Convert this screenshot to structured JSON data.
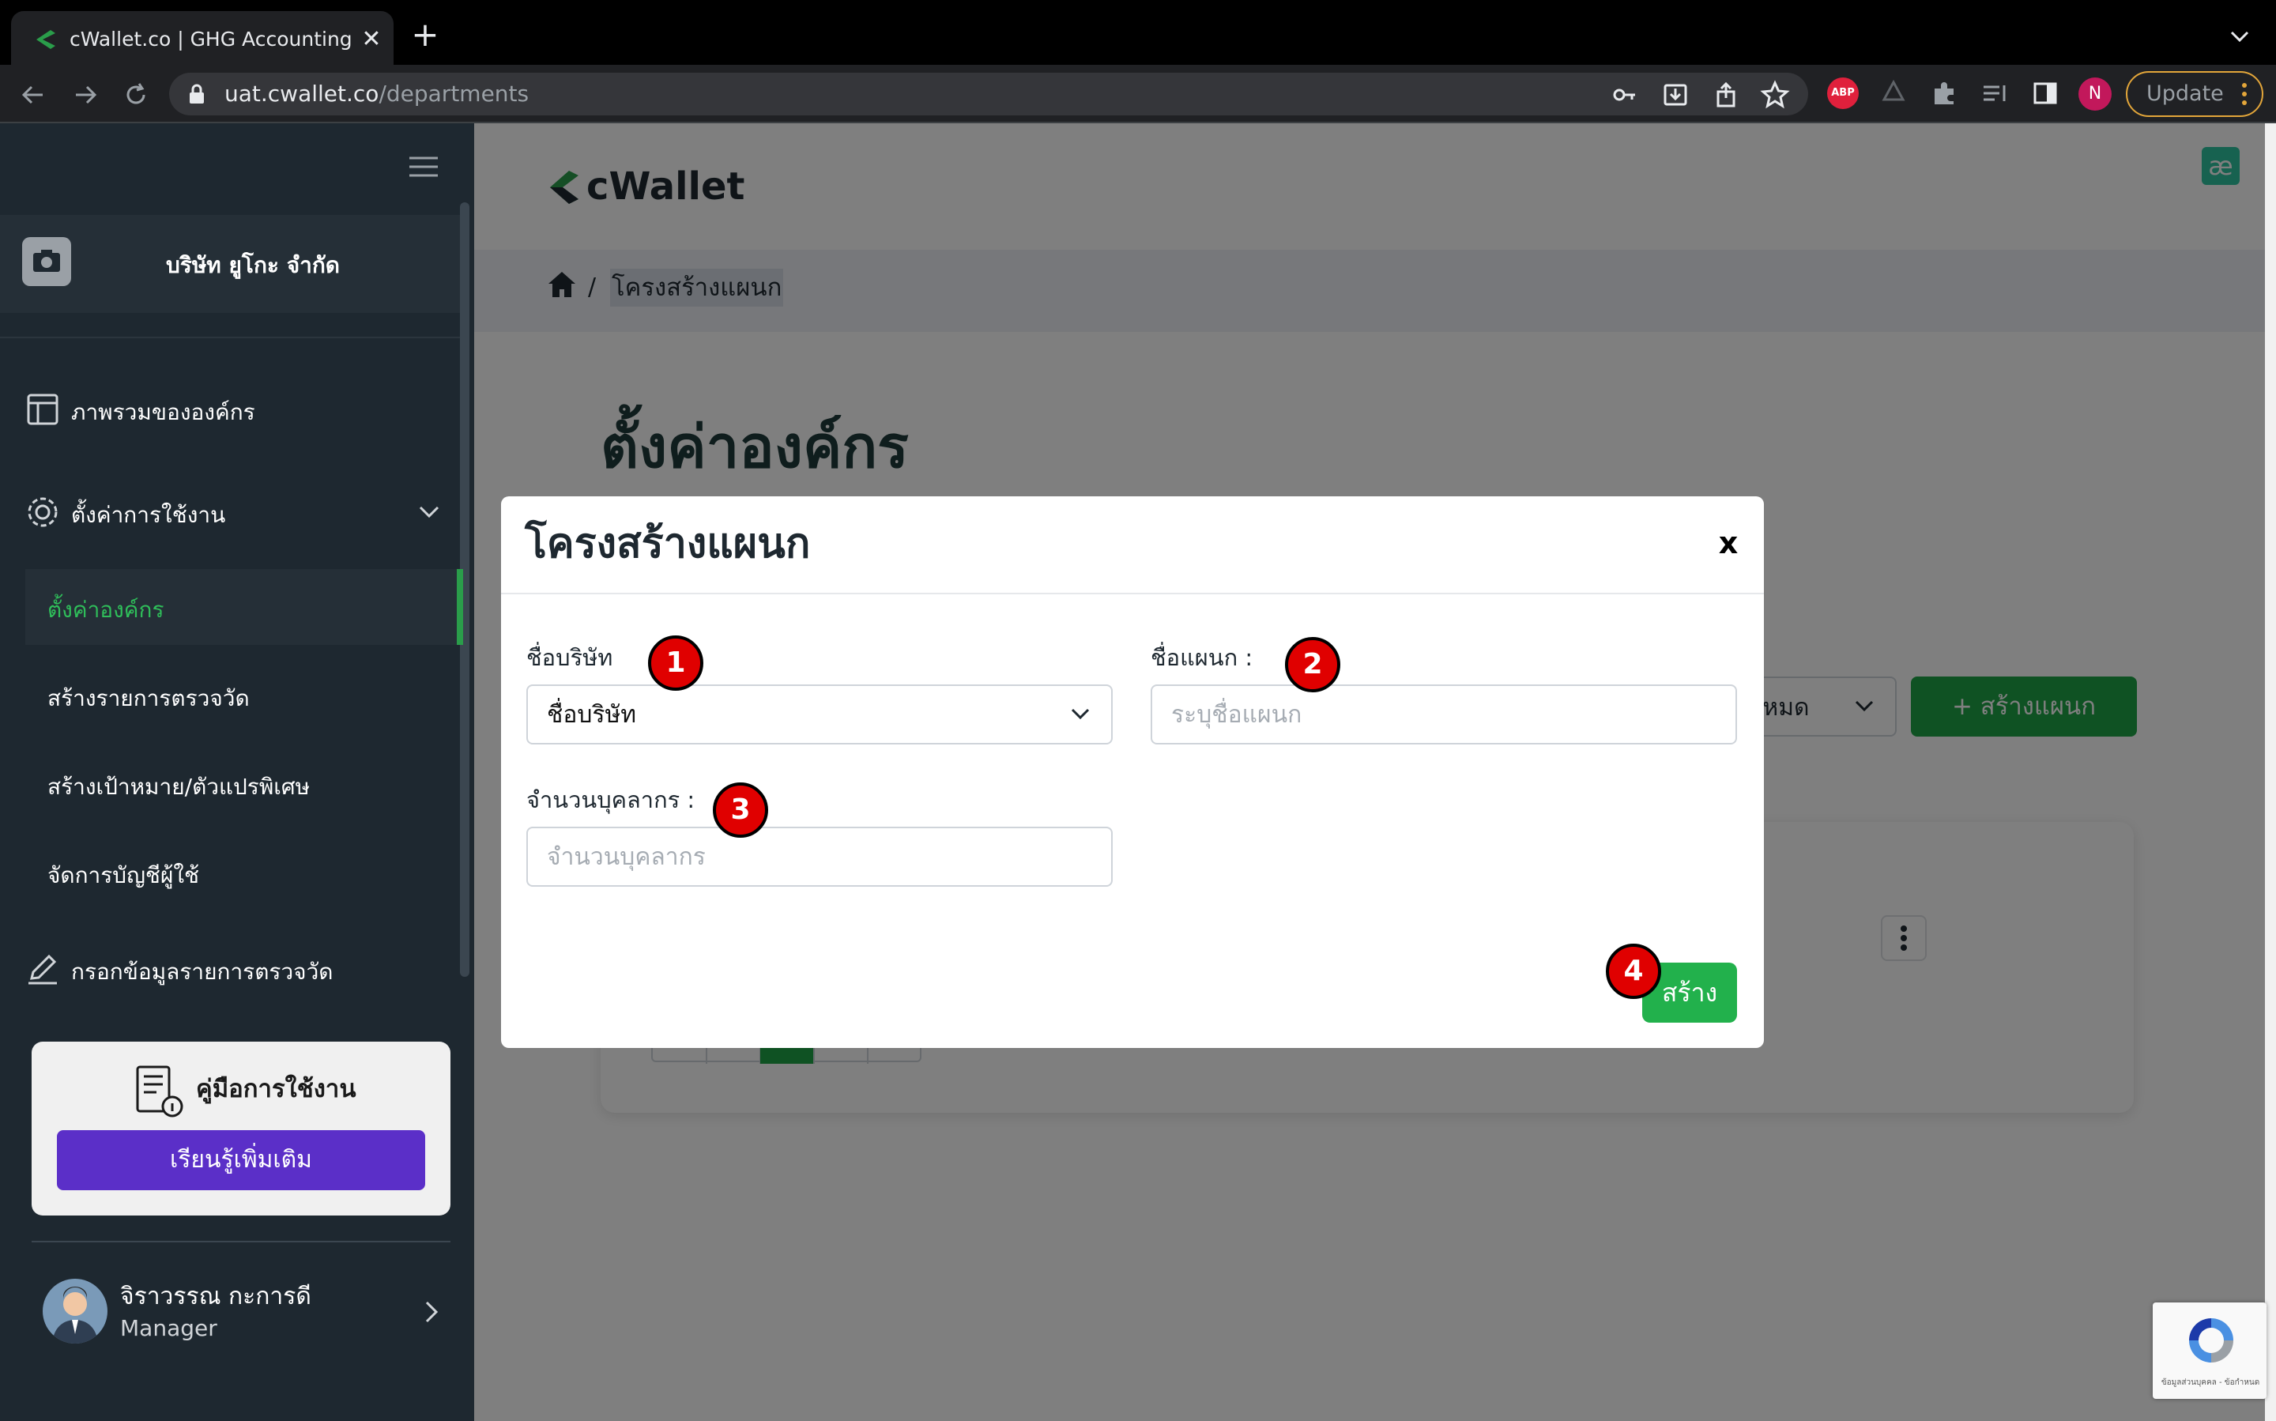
{
  "browser": {
    "tab_title": "cWallet.co | GHG Accounting S",
    "tab_close": "✕",
    "new_tab": "+",
    "url_host": "uat.cwallet.co",
    "url_path": "/departments",
    "profile_initial": "N",
    "update_label": "Update",
    "abp_label": "ABP"
  },
  "sidebar": {
    "company_name": "บริษัท ยูโกะ จำกัด",
    "items": [
      {
        "label": "ภาพรวมขององค์กร",
        "icon": "layout-icon"
      },
      {
        "label": "ตั้งค่าการใช้งาน",
        "icon": "gear-icon"
      },
      {
        "label": "ตั้งค่าองค์กร"
      },
      {
        "label": "สร้างรายการตรวจวัด"
      },
      {
        "label": "สร้างเป้าหมาย/ตัวแปรพิเศษ"
      },
      {
        "label": "จัดการบัญชีผู้ใช้"
      },
      {
        "label": "กรอกข้อมูลรายการตรวจวัด",
        "icon": "edit-icon"
      }
    ],
    "manual": {
      "title": "คู่มือการใช้งาน",
      "button": "เรียนรู้เพิ่มเติม"
    },
    "user": {
      "name": "จิราวรรณ กะการดี",
      "role": "Manager"
    }
  },
  "header": {
    "logo_text": "cWallet",
    "badge": "æ",
    "breadcrumb_sep": "/",
    "breadcrumb_current": "โครงสร้างแผนก"
  },
  "main": {
    "page_title": "ตั้งค่าองค์กร",
    "filter_partial": "ทั้งหมด",
    "create_button": "+ สร้างแผนก"
  },
  "modal": {
    "title": "โครงสร้างแผนก",
    "close": "x",
    "fields": {
      "company": {
        "label": "ชื่อบริษัท",
        "value": "ชื่อบริษัท"
      },
      "department": {
        "label": "ชื่อแผนก :",
        "placeholder": "ระบุชื่อแผนก"
      },
      "headcount": {
        "label": "จำนวนบุคลากร :",
        "placeholder": "จำนวนบุคลากร"
      }
    },
    "submit": "สร้าง"
  },
  "markers": [
    "1",
    "2",
    "3",
    "4"
  ],
  "recaptcha_text": "ข้อมูลส่วนบุคคล - ข้อกำหนด",
  "colors": {
    "sidebar": "#1e2830",
    "accent_green": "#1ea446",
    "manual_button": "#5b2fc8",
    "marker_red": "#e00000"
  }
}
